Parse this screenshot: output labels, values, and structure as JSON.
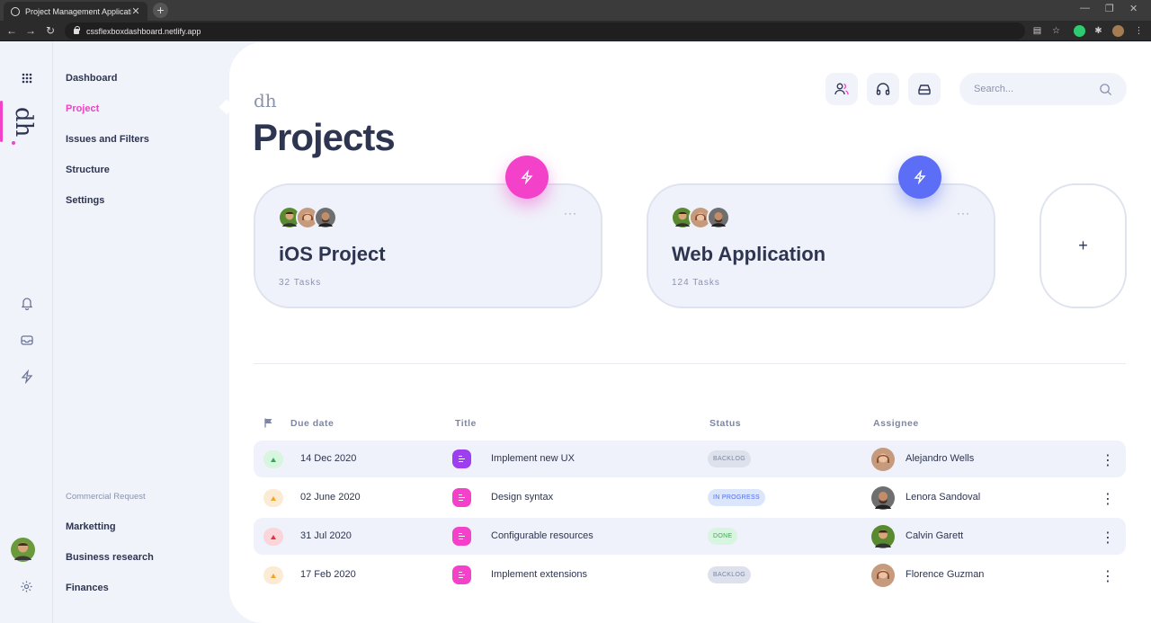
{
  "browser": {
    "tab_title": "Project Management Application",
    "tab_close": "✕",
    "new_tab": "+",
    "url": "cssflexboxdashboard.netlify.app"
  },
  "rail": {
    "brand": "dh",
    "icons": [
      "grid-icon",
      "bell-icon",
      "inbox-icon",
      "bolt-icon",
      "settings-icon"
    ]
  },
  "nav": {
    "items": [
      {
        "label": "Dashboard",
        "active": false
      },
      {
        "label": "Project",
        "active": true
      },
      {
        "label": "Issues and Filters",
        "active": false
      },
      {
        "label": "Structure",
        "active": false
      },
      {
        "label": "Settings",
        "active": false
      }
    ],
    "section_title": "Commercial Request",
    "section_items": [
      "Marketting",
      "Business research",
      "Finances"
    ]
  },
  "header": {
    "logo": "dh",
    "title": "Projects",
    "search_placeholder": "Search...",
    "buttons": [
      "users-icon",
      "headphones-icon",
      "inbox-icon"
    ]
  },
  "projects": [
    {
      "title": "iOS Project",
      "tasks": "32 Tasks",
      "more": "···",
      "accent": "#f341c9"
    },
    {
      "title": "Web Application",
      "tasks": "124 Tasks",
      "more": "···",
      "accent": "#5b6ef5"
    }
  ],
  "add_project": "+",
  "table": {
    "columns": [
      "Due date",
      "Title",
      "Status",
      "Assignee"
    ],
    "rows": [
      {
        "priority": "low",
        "priority_color": "#27b350",
        "priority_bg": "#d7f5df",
        "due": "14 Dec 2020",
        "title": "Implement new UX",
        "icon_color": "#9d3ef0",
        "status": "BACKLOG",
        "status_color": "#7d86a3",
        "status_bg": "#dde1ec",
        "assignee": "Alejandro Wells"
      },
      {
        "priority": "medium",
        "priority_color": "#f5a524",
        "priority_bg": "#fcebd4",
        "due": "02 June 2020",
        "title": "Design syntax",
        "icon_color": "#f341c9",
        "status": "IN PROGRESS",
        "status_color": "#4f6cf0",
        "status_bg": "#dce6fb",
        "assignee": "Lenora Sandoval"
      },
      {
        "priority": "high",
        "priority_color": "#e8303f",
        "priority_bg": "#fad5d9",
        "due": "31 Jul 2020",
        "title": "Configurable resources",
        "icon_color": "#f341c9",
        "status": "DONE",
        "status_color": "#2fb14e",
        "status_bg": "#d8f5df",
        "assignee": "Calvin Garett"
      },
      {
        "priority": "medium",
        "priority_color": "#f5a524",
        "priority_bg": "#fcebd4",
        "due": "17 Feb 2020",
        "title": "Implement extensions",
        "icon_color": "#f341c9",
        "status": "BACKLOG",
        "status_color": "#7d86a3",
        "status_bg": "#dde1ec",
        "assignee": "Florence Guzman"
      }
    ]
  }
}
